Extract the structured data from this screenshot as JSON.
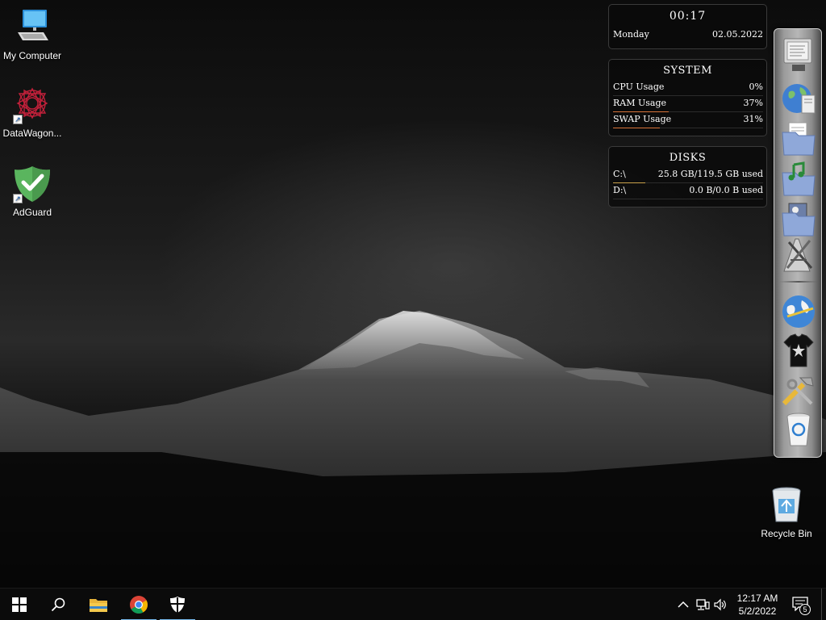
{
  "desktop": {
    "icons": [
      {
        "label": "My Computer"
      },
      {
        "label": "DataWagon..."
      },
      {
        "label": "AdGuard"
      }
    ],
    "recycle_bin_label": "Recycle Bin"
  },
  "gadgets": {
    "clock": {
      "time": "00:17",
      "day": "Monday",
      "date": "02.05.2022"
    },
    "system": {
      "title": "SYSTEM",
      "rows": [
        {
          "label": "CPU Usage",
          "value": "0%",
          "fraction": 0.0
        },
        {
          "label": "RAM Usage",
          "value": "37%",
          "fraction": 0.37
        },
        {
          "label": "SWAP Usage",
          "value": "31%",
          "fraction": 0.31
        }
      ],
      "bar_color": "#d8733a"
    },
    "disks": {
      "title": "DISKS",
      "rows": [
        {
          "label": "C:\\",
          "value": "25.8 GB/119.5 GB used",
          "fraction": 0.216
        },
        {
          "label": "D:\\",
          "value": "0.0 B/0.0 B used",
          "fraction": 0.0
        }
      ],
      "bar_color": "#caa24a"
    }
  },
  "dock": {
    "items": [
      {
        "icon": "monitor-icon"
      },
      {
        "icon": "network-globe-icon"
      },
      {
        "icon": "documents-folder-icon"
      },
      {
        "icon": "music-folder-icon"
      },
      {
        "icon": "pictures-folder-icon"
      },
      {
        "icon": "applications-icon"
      },
      {
        "icon": "globe-icon"
      },
      {
        "icon": "tshirt-icon"
      },
      {
        "icon": "tools-icon"
      },
      {
        "icon": "trash-icon"
      }
    ]
  },
  "taskbar": {
    "buttons": [
      {
        "icon": "windows-start-icon"
      },
      {
        "icon": "search-icon"
      },
      {
        "icon": "file-explorer-icon"
      },
      {
        "icon": "chrome-icon"
      },
      {
        "icon": "security-shield-icon"
      }
    ],
    "clock_time": "12:17 AM",
    "clock_date": "5/2/2022",
    "notification_count": "5",
    "accent": "#76b9ed"
  }
}
